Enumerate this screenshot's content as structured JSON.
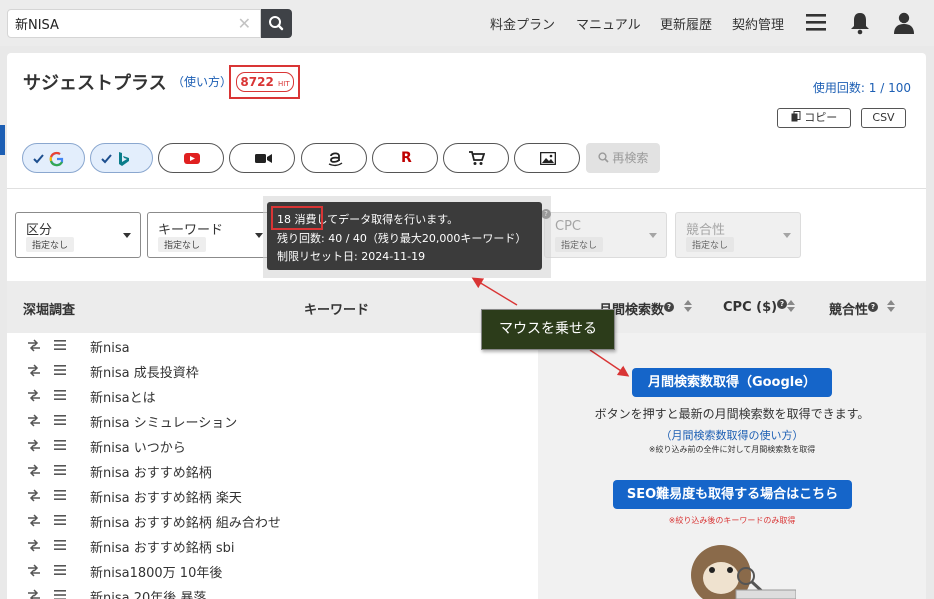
{
  "search": {
    "value": "新NISA"
  },
  "nav": {
    "plans": "料金プラン",
    "manual": "マニュアル",
    "history": "更新履歴",
    "contract": "契約管理"
  },
  "header": {
    "title": "サジェストプラス",
    "howto": "（使い方）",
    "hit_count": "8722",
    "hit_unit": "HIT",
    "usage": "使用回数: 1 / 100",
    "copy_label": "コピー",
    "csv_label": "CSV"
  },
  "engines": {
    "recheck_label": "再検索",
    "rakuten_glyph": "R",
    "items": [
      "google-icon",
      "bing-icon",
      "youtube-icon",
      "video-icon",
      "amazon-icon",
      "rakuten-icon",
      "cart-icon",
      "image-icon"
    ]
  },
  "filters": {
    "category": {
      "label": "区分",
      "value": "指定なし"
    },
    "keyword": {
      "label": "キーワード",
      "value": "指定なし"
    },
    "cpc": {
      "label": "CPC",
      "value": "指定なし"
    },
    "competition": {
      "label": "競合性",
      "value": "指定なし"
    }
  },
  "tooltip": {
    "line1_highlight": "18 消費",
    "line1_rest": "してデータ取得を行います。",
    "line2": "残り回数: 40 / 40（残り最大20,000キーワード）",
    "line3": "制限リセット日: 2024-11-19"
  },
  "callout": "マウスを乗せる",
  "table": {
    "headers": {
      "dig": "深堀調査",
      "keyword": "キーワード",
      "monthly": "月間検索数",
      "cpc": "CPC ($)",
      "competition": "競合性"
    },
    "rows": [
      "新nisa",
      "新nisa 成長投資枠",
      "新nisaとは",
      "新nisa シミュレーション",
      "新nisa いつから",
      "新nisa おすすめ銘柄",
      "新nisa おすすめ銘柄 楽天",
      "新nisa おすすめ銘柄 組み合わせ",
      "新nisa おすすめ銘柄 sbi",
      "新nisa1800万 10年後",
      "新nisa 20年後 暴落"
    ]
  },
  "right_panel": {
    "fetch_button": "月間検索数取得（Google）",
    "fetch_desc": "ボタンを押すと最新の月間検索数を取得できます。",
    "fetch_howto": "（月間検索数取得の使い方）",
    "fetch_note": "※絞り込み前の全件に対して月間検索数を取得",
    "seo_button": "SEO難易度も取得する場合はこちら",
    "seo_note": "※絞り込み後のキーワードのみ取得"
  }
}
